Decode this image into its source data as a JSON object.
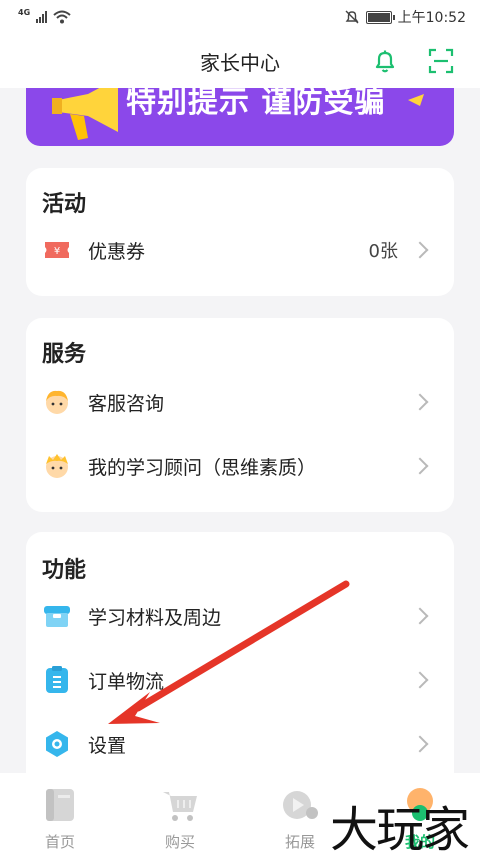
{
  "status_bar": {
    "network": "4G",
    "time": "上午10:52"
  },
  "header": {
    "title": "家长中心",
    "icons": [
      "bell-icon",
      "scan-icon"
    ]
  },
  "banner": {
    "text": "特别提示 谨防受骗"
  },
  "sections": {
    "activity": {
      "title": "活动",
      "items": [
        {
          "label": "优惠券",
          "value": "0张",
          "icon": "coupon-icon"
        }
      ]
    },
    "service": {
      "title": "服务",
      "items": [
        {
          "label": "客服咨询",
          "icon": "service-avatar-icon"
        },
        {
          "label": "我的学习顾问（思维素质）",
          "icon": "advisor-avatar-icon"
        }
      ]
    },
    "functions": {
      "title": "功能",
      "items": [
        {
          "label": "学习材料及周边",
          "icon": "materials-icon"
        },
        {
          "label": "订单物流",
          "icon": "order-icon"
        },
        {
          "label": "设置",
          "icon": "settings-icon"
        }
      ]
    }
  },
  "tabbar": {
    "tabs": [
      {
        "label": "首页",
        "icon": "home-book-icon"
      },
      {
        "label": "购买",
        "icon": "cart-icon"
      },
      {
        "label": "拓展",
        "icon": "expand-play-icon"
      },
      {
        "label": "我的",
        "icon": "profile-icon",
        "active": true
      }
    ]
  },
  "watermark": {
    "text": "大玩家"
  },
  "colors": {
    "accent_green": "#1cbf70",
    "banner_purple": "#8b48ea",
    "banner_yellow": "#ffd43b",
    "arrow_red": "#e53528"
  }
}
